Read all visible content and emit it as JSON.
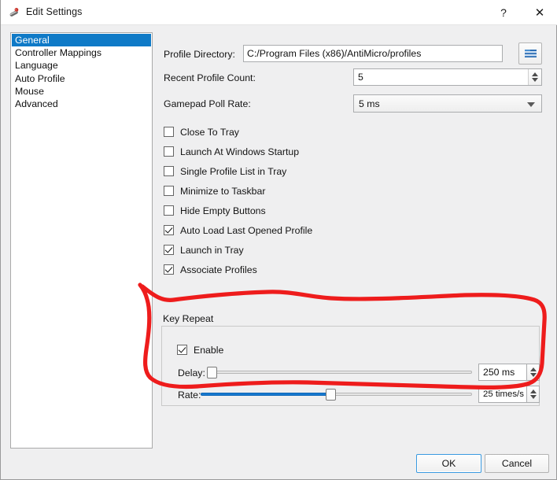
{
  "window": {
    "title": "Edit Settings",
    "icon": "gamepad-icon",
    "help_label": "?",
    "close_label": "✕"
  },
  "sidebar": {
    "items": [
      {
        "label": "General",
        "selected": true
      },
      {
        "label": "Controller Mappings",
        "selected": false
      },
      {
        "label": "Language",
        "selected": false
      },
      {
        "label": "Auto Profile",
        "selected": false
      },
      {
        "label": "Mouse",
        "selected": false
      },
      {
        "label": "Advanced",
        "selected": false
      }
    ]
  },
  "general": {
    "profile_directory": {
      "label": "Profile Directory:",
      "value": "C:/Program Files (x86)/AntiMicro/profiles",
      "browse_icon": "folder-icon"
    },
    "recent_profile_count": {
      "label": "Recent Profile Count:",
      "value": "5"
    },
    "gamepad_poll_rate": {
      "label": "Gamepad Poll Rate:",
      "value": "5 ms"
    },
    "checkboxes": [
      {
        "label": "Close To Tray",
        "checked": false
      },
      {
        "label": "Launch At Windows Startup",
        "checked": false
      },
      {
        "label": "Single Profile List in Tray",
        "checked": false
      },
      {
        "label": "Minimize to Taskbar",
        "checked": false
      },
      {
        "label": "Hide Empty Buttons",
        "checked": false
      },
      {
        "label": "Auto Load Last Opened Profile",
        "checked": true
      },
      {
        "label": "Launch in Tray",
        "checked": true
      },
      {
        "label": "Associate Profiles",
        "checked": true
      }
    ]
  },
  "key_repeat": {
    "title": "Key Repeat",
    "enable": {
      "label": "Enable",
      "checked": true
    },
    "delay": {
      "label": "Delay:",
      "value": "250 ms",
      "slider_percent": 1
    },
    "rate": {
      "label": "Rate:",
      "value": "25 times/s",
      "slider_percent": 48
    }
  },
  "footer": {
    "ok_label": "OK",
    "cancel_label": "Cancel"
  },
  "annotation": {
    "type": "freehand-ellipse",
    "color": "#ee1c1c",
    "target": "Key Repeat"
  },
  "colors": {
    "accent": "#0f7ac7",
    "slider_fill": "#1678cf",
    "window_bg": "#efeff0",
    "titlebar_bg": "#ffffff",
    "annotation": "#ee1c1c"
  }
}
